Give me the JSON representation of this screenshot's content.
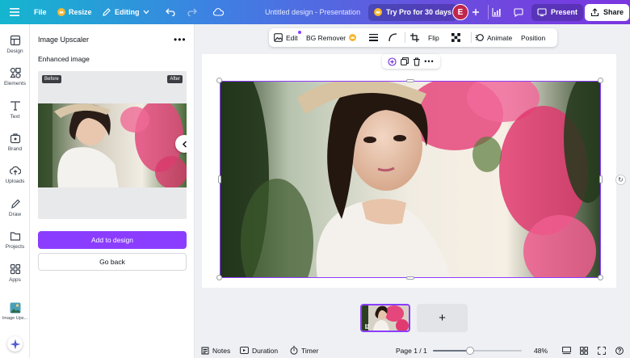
{
  "topbar": {
    "menu_icon": "hamburger-icon",
    "file_label": "File",
    "resize_label": "Resize",
    "editing_label": "Editing",
    "doc_title": "Untitled design - Presentation",
    "try_pro_label": "Try Pro for 30 days",
    "avatar_initial": "E",
    "present_label": "Present",
    "share_label": "Share"
  },
  "rail": {
    "items": [
      {
        "label": "Design",
        "icon": "design-icon"
      },
      {
        "label": "Elements",
        "icon": "elements-icon"
      },
      {
        "label": "Text",
        "icon": "text-icon"
      },
      {
        "label": "Brand",
        "icon": "brand-icon"
      },
      {
        "label": "Uploads",
        "icon": "uploads-icon"
      },
      {
        "label": "Draw",
        "icon": "draw-icon"
      },
      {
        "label": "Projects",
        "icon": "projects-icon"
      },
      {
        "label": "Apps",
        "icon": "apps-icon"
      },
      {
        "label": "Image Ups...",
        "icon": "image-upscaler-app-icon"
      }
    ]
  },
  "panel": {
    "title": "Image Upscaler",
    "subtitle": "Enhanced image",
    "before_tag": "Before",
    "after_tag": "After",
    "add_button": "Add to design",
    "back_button": "Go back"
  },
  "context_toolbar": {
    "edit_label": "Edit",
    "bg_remover_label": "BG Remover",
    "flip_label": "Flip",
    "animate_label": "Animate",
    "position_label": "Position"
  },
  "thumbnail": {
    "page_number": "1"
  },
  "add_page": {
    "label": "+"
  },
  "bottombar": {
    "notes_label": "Notes",
    "duration_label": "Duration",
    "timer_label": "Timer",
    "page_indicator": "Page 1 / 1",
    "zoom_label": "48%",
    "zoom_fraction": 0.42
  },
  "colors": {
    "accent": "#8b3dff",
    "gradient_start": "#14b6cf",
    "gradient_end": "#7a36e0"
  }
}
